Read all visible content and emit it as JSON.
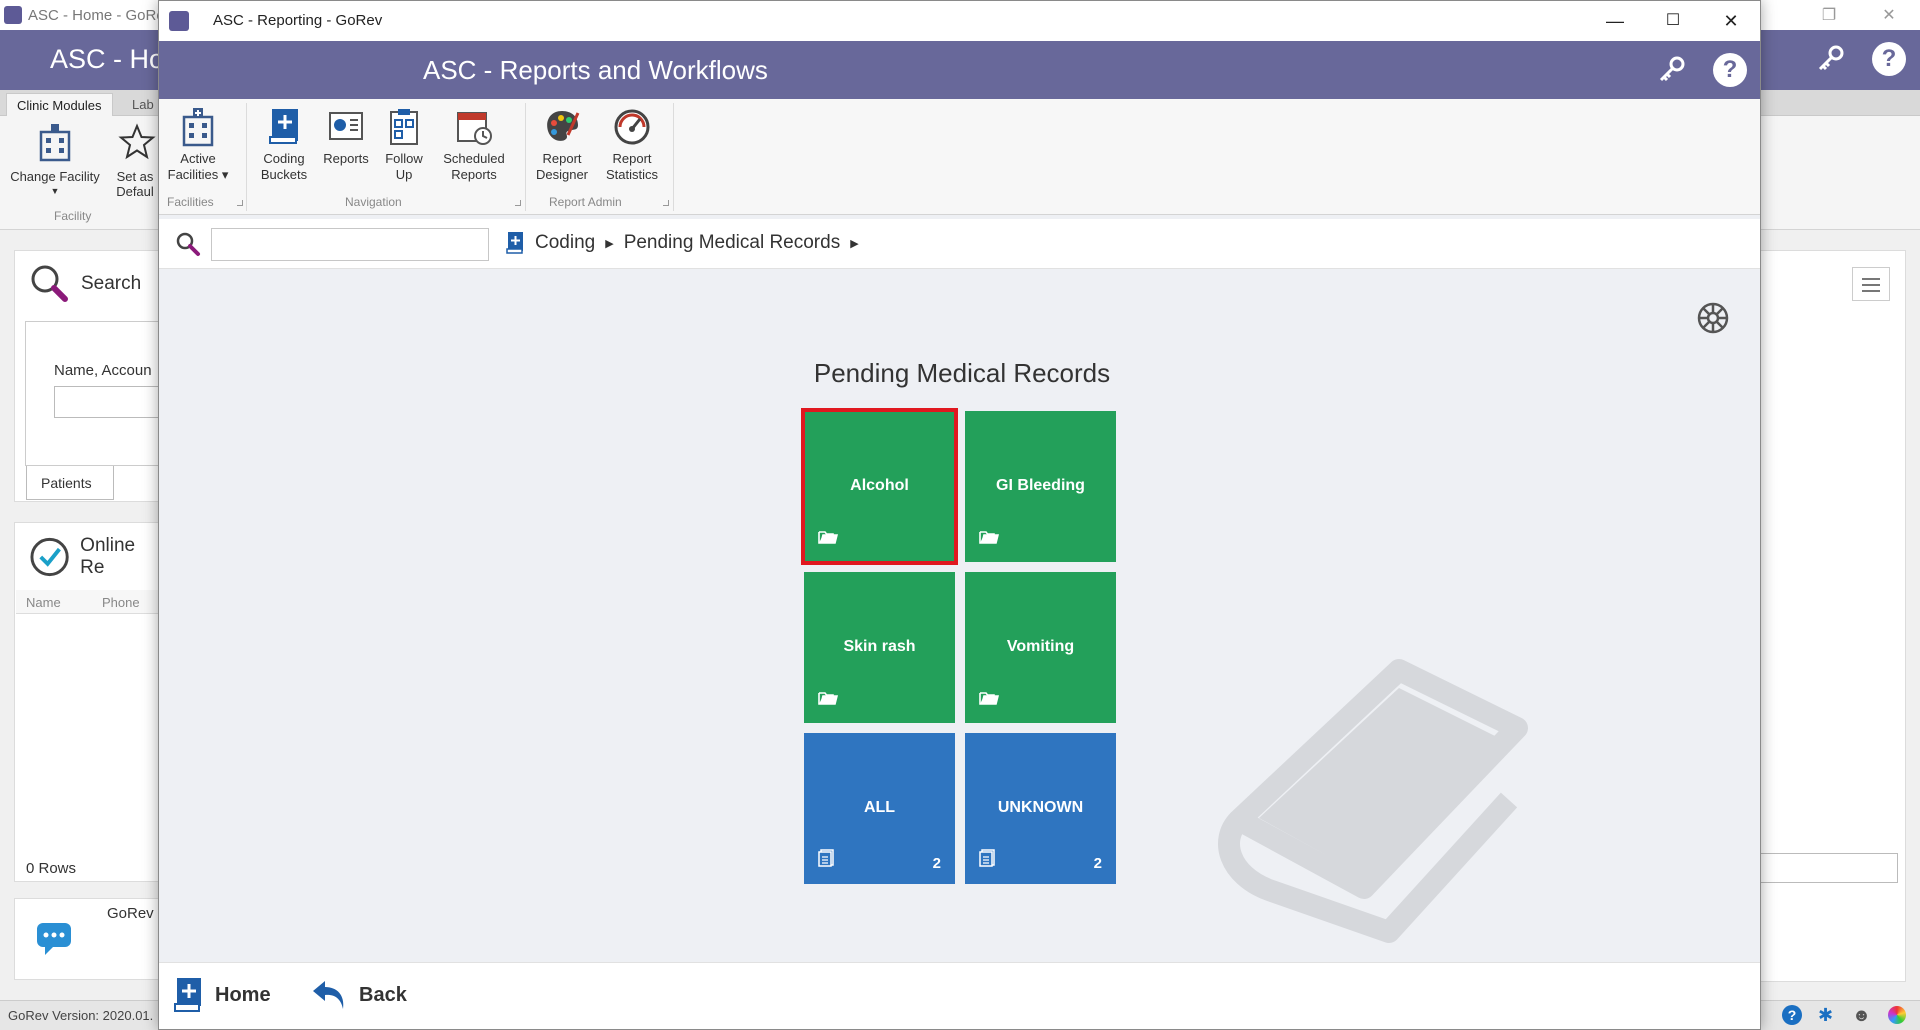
{
  "background_window": {
    "title": "ASC - Home - GoRe",
    "app_title": "ASC - Ho",
    "tabs": [
      "Clinic Modules",
      "Lab"
    ],
    "ribbon": {
      "change_facility": "Change Facility",
      "set_default": "Set as Defaul",
      "group_facility": "Facility"
    },
    "search": {
      "heading": "Search",
      "field_label": "Name, Accoun",
      "tab_patients": "Patients"
    },
    "online": {
      "heading": "Online Re",
      "col_name": "Name",
      "col_phone": "Phone",
      "rows_label": "0 Rows"
    },
    "chat_label": "GoRev",
    "status_version": "GoRev Version: 2020.01."
  },
  "window": {
    "title": "ASC - Reporting - GoRev",
    "app_title": "ASC - Reports and Workflows",
    "minimize": "—",
    "maximize": "☐",
    "close": "✕"
  },
  "ribbon": {
    "active_facilities": [
      "Active",
      "Facilities ▾"
    ],
    "coding_buckets": [
      "Coding",
      "Buckets"
    ],
    "reports": "Reports",
    "follow_up": [
      "Follow",
      "Up"
    ],
    "scheduled_reports": [
      "Scheduled",
      "Reports"
    ],
    "report_designer": [
      "Report",
      "Designer"
    ],
    "report_statistics": [
      "Report",
      "Statistics"
    ],
    "groups": {
      "facilities": "Facilities",
      "navigation": "Navigation",
      "report_admin": "Report Admin"
    }
  },
  "navbar": {
    "search_value": "",
    "breadcrumb": [
      "Coding",
      "Pending Medical Records"
    ]
  },
  "page": {
    "heading": "Pending Medical Records"
  },
  "tiles": [
    {
      "label": "Alcohol",
      "color": "#23a05a",
      "icon": "folder-open-icon",
      "count": "",
      "selected": true
    },
    {
      "label": "GI Bleeding",
      "color": "#23a05a",
      "icon": "folder-open-icon",
      "count": "",
      "selected": false
    },
    {
      "label": "Skin rash",
      "color": "#23a05a",
      "icon": "folder-open-icon",
      "count": "",
      "selected": false
    },
    {
      "label": "Vomiting",
      "color": "#23a05a",
      "icon": "folder-open-icon",
      "count": "",
      "selected": false
    },
    {
      "label": "ALL",
      "color": "#2f75c0",
      "icon": "document-icon",
      "count": "2",
      "selected": false
    },
    {
      "label": "UNKNOWN",
      "color": "#2f75c0",
      "icon": "document-icon",
      "count": "2",
      "selected": false
    }
  ],
  "footer": {
    "home": "Home",
    "back": "Back"
  },
  "colors": {
    "header": "#68689a",
    "tile_green": "#23a05a",
    "tile_blue": "#2f75c0",
    "selection": "#e0181f"
  }
}
